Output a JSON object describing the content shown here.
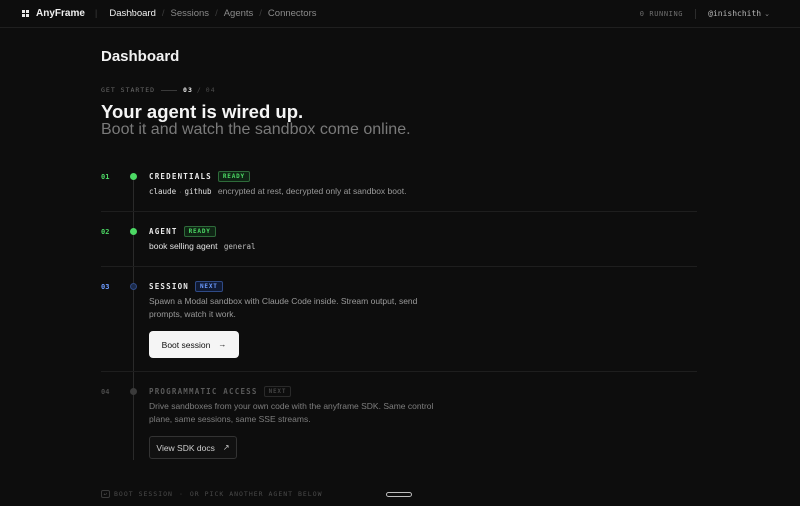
{
  "nav": {
    "brand": "AnyFrame",
    "items": [
      {
        "label": "Dashboard"
      },
      {
        "label": "Sessions"
      },
      {
        "label": "Agents"
      },
      {
        "label": "Connectors"
      }
    ],
    "running": "0 RUNNING",
    "user": "@inishchith"
  },
  "page": {
    "title": "Dashboard",
    "get_started": "GET STARTED",
    "step_current": "03",
    "step_total": "04",
    "headline": "Your agent is wired up.",
    "subheadline": "Boot it and watch the sandbox come online."
  },
  "steps": [
    {
      "num": "01",
      "title": "CREDENTIALS",
      "badge": "READY",
      "code_a": "claude",
      "code_b": "github",
      "desc": "encrypted at rest, decrypted only at sandbox boot."
    },
    {
      "num": "02",
      "title": "AGENT",
      "badge": "READY",
      "agent_name": "book selling agent",
      "agent_tag": "general"
    },
    {
      "num": "03",
      "title": "SESSION",
      "badge": "NEXT",
      "desc_line1": "Spawn a Modal sandbox with Claude Code inside. Stream output, send",
      "desc_line2": "prompts, watch it work.",
      "button": "Boot session"
    },
    {
      "num": "04",
      "title": "PROGRAMMATIC ACCESS",
      "badge": "NEXT",
      "desc_line1": "Drive sandboxes from your own code with the anyframe SDK. Same control",
      "desc_line2": "plane, same sessions, same SSE streams.",
      "button": "View SDK docs"
    }
  ],
  "footer": {
    "hint_a": "BOOT SESSION",
    "hint_b": "OR PICK ANOTHER AGENT BELOW"
  },
  "colors": {
    "ready_green": "#4cd964",
    "next_blue": "#6c9bff",
    "background": "#0d0d0d"
  }
}
